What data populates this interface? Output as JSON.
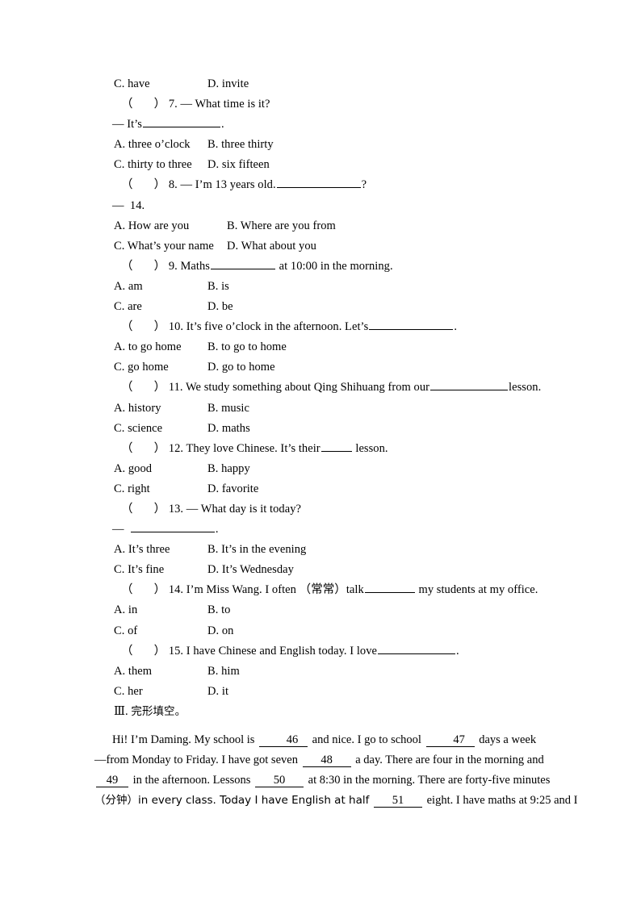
{
  "document": {
    "type": "exam-worksheet",
    "language": "en-zh",
    "page_background": "#ffffff",
    "text_color": "#000000"
  },
  "questions": [
    {
      "id": "q6-options-tail",
      "kind": "options",
      "a": "C. have",
      "b": "D. invite"
    },
    {
      "id": "q7",
      "kind": "question",
      "bracket_open": "（",
      "bracket_close": "）",
      "number": "7.",
      "stem": "— What time is it?",
      "continuation_dash": "—",
      "continuation_pre": "It’s",
      "continuation_post": ".",
      "options": [
        {
          "a": "A. three o’clock",
          "b": "B. three thirty"
        },
        {
          "a": "C. thirty to three",
          "b": "D. six fifteen"
        }
      ]
    },
    {
      "id": "q8",
      "kind": "question",
      "bracket_open": "（",
      "bracket_close": "）",
      "number": "8.",
      "stem": "— I’m 13 years old.",
      "stem_post": "?",
      "continuation_dash": "—",
      "continuation_text": "14.",
      "options": [
        {
          "a": "A. How are you",
          "b": "B. Where are you from"
        },
        {
          "a": "C. What’s your name",
          "b": "D. What about you"
        }
      ]
    },
    {
      "id": "q9",
      "kind": "question",
      "bracket_open": "（",
      "bracket_close": "）",
      "number": "9.",
      "stem_pre": "Maths",
      "stem_post": "at 10:00 in the morning.",
      "options": [
        {
          "a": "A. am",
          "b": "B. is"
        },
        {
          "a": "C. are",
          "b": "D. be"
        }
      ]
    },
    {
      "id": "q10",
      "kind": "question",
      "bracket_open": "（",
      "bracket_close": "）",
      "number": "10.",
      "stem_pre": "It’s five o’clock in the afternoon. Let’s",
      "stem_post": ".",
      "options": [
        {
          "a": "A. to go home",
          "b": "B. to go to home"
        },
        {
          "a": "C. go home",
          "b": "D. go to home"
        }
      ]
    },
    {
      "id": "q11",
      "kind": "question",
      "bracket_open": "（",
      "bracket_close": "）",
      "number": "11.",
      "stem_pre": "We study something about Qing Shihuang from our",
      "stem_post": "lesson.",
      "options": [
        {
          "a": "A. history",
          "b": "B. music"
        },
        {
          "a": "C. science",
          "b": "D. maths"
        }
      ]
    },
    {
      "id": "q12",
      "kind": "question",
      "bracket_open": "（",
      "bracket_close": "）",
      "number": "12.",
      "stem_pre": "They love Chinese. It’s their",
      "stem_post": "lesson.",
      "options": [
        {
          "a": "A. good",
          "b": "B. happy"
        },
        {
          "a": "C. right",
          "b": "D. favorite"
        }
      ]
    },
    {
      "id": "q13",
      "kind": "question",
      "bracket_open": "（",
      "bracket_close": "）",
      "number": "13.",
      "stem": "— What day is it today?",
      "continuation_dash": "—",
      "continuation_post": ".",
      "options": [
        {
          "a": "A. It’s three",
          "b": "B. It’s in the evening"
        },
        {
          "a": "C. It’s fine",
          "b": "D. It’s Wednesday"
        }
      ]
    },
    {
      "id": "q14",
      "kind": "question",
      "bracket_open": "（",
      "bracket_close": "）",
      "number": "14.",
      "stem_pre": "I’m Miss Wang. I often （常常）talk",
      "stem_post": "my students at my office.",
      "options": [
        {
          "a": "A. in",
          "b": "B. to"
        },
        {
          "a": "C. of",
          "b": "D. on"
        }
      ]
    },
    {
      "id": "q15",
      "kind": "question",
      "bracket_open": "（",
      "bracket_close": "）",
      "number": "15.",
      "stem_pre": "I have Chinese and English today. I love",
      "stem_post": ".",
      "options": [
        {
          "a": "A. them",
          "b": "B. him"
        },
        {
          "a": "C. her",
          "b": "D. it"
        }
      ]
    }
  ],
  "section": {
    "numeral": "Ⅲ.",
    "title": "完形填空。"
  },
  "cloze": {
    "line1_pre": "Hi! I’m Daming. My school is",
    "blank46": "46",
    "line1_mid": "and nice. I go to school",
    "blank47": "47",
    "line1_post": "days a week",
    "line2_dash": "—",
    "line2_pre": "from Monday to Friday. I have got seven",
    "blank48": "48",
    "line2_post": "a day. There are four in the morning and",
    "blank49": "49",
    "line3_pre": "in the afternoon. Lessons",
    "blank50": "50",
    "line3_post": "at 8:30 in the morning. There are forty-five minutes",
    "line4_pre": "（分钟）in every class. Today I have English at half",
    "blank51": "51",
    "line4_post": "eight. I have maths at 9:25 and I"
  }
}
